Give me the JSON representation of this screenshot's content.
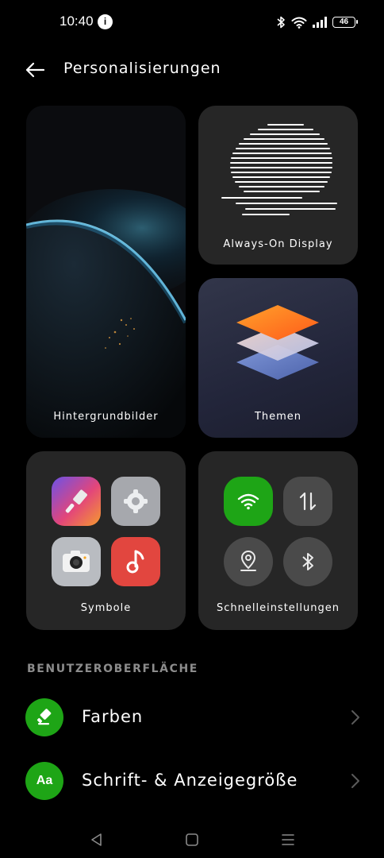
{
  "status_bar": {
    "time": "10:40",
    "notification_badge": "i",
    "battery": "46",
    "icons": [
      "bluetooth-icon",
      "wifi-icon",
      "signal-icon",
      "battery-icon"
    ]
  },
  "header": {
    "title": "Personalisierungen",
    "back_icon": "arrow-left-icon"
  },
  "cards": {
    "wallpapers": {
      "label": "Hintergrundbilder"
    },
    "aod": {
      "label": "Always-On Display"
    },
    "themes": {
      "label": "Themen"
    },
    "icons": {
      "label": "Symbole",
      "apps": [
        "brush-app-icon",
        "settings-gear-icon",
        "camera-icon",
        "music-note-icon"
      ]
    },
    "quick_settings": {
      "label": "Schnelleinstellungen",
      "toggles": [
        "wifi-icon",
        "mobile-data-icon",
        "location-icon",
        "bluetooth-icon"
      ]
    }
  },
  "section": {
    "title": "BENUTZEROBERFLÄCHE",
    "items": [
      {
        "label": "Farben",
        "icon": "brush-icon"
      },
      {
        "label": "Schrift- & Anzeigegröße",
        "icon_text": "Aa"
      }
    ]
  },
  "colors": {
    "accent": "#1ea516",
    "card_bg": "#262626",
    "background": "#000000"
  },
  "nav_bar": [
    "back-triangle-icon",
    "home-square-icon",
    "recents-menu-icon"
  ]
}
